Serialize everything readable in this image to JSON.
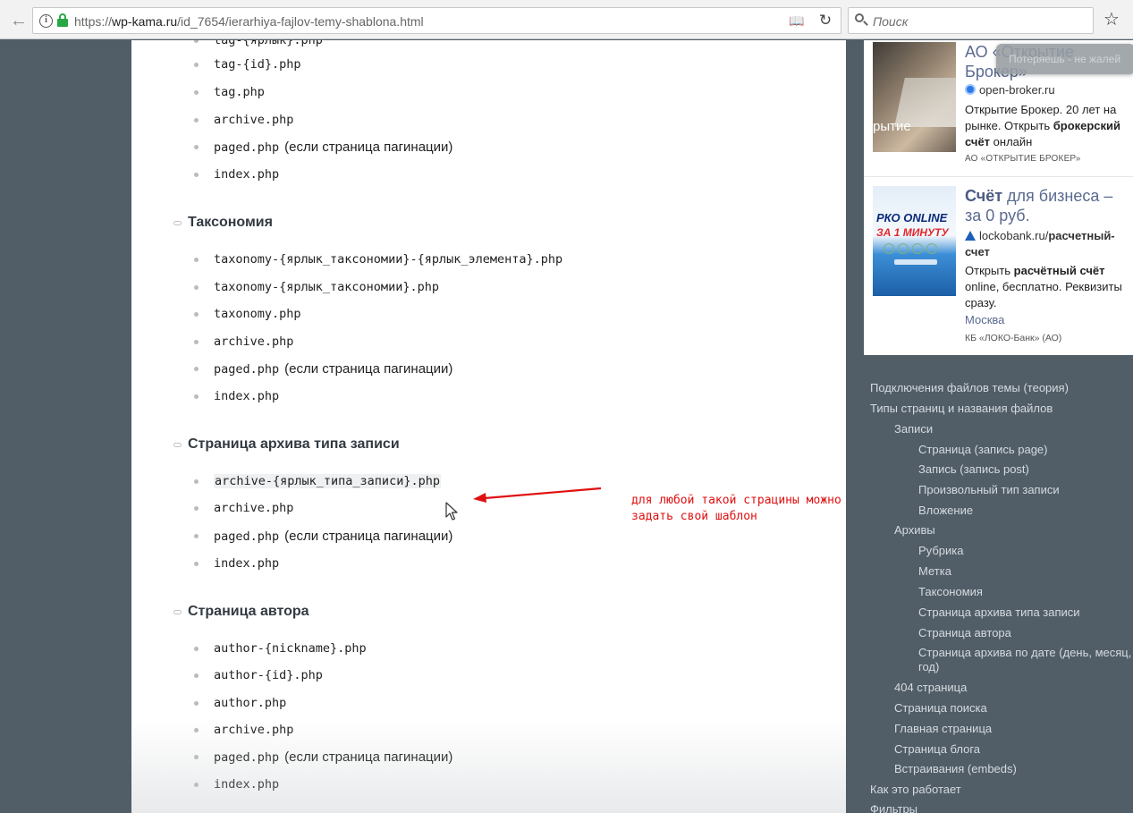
{
  "browser": {
    "url_prefix": "https://",
    "url_host": "wp-kama.ru",
    "url_path": "/id_7654/ierarhiya-fajlov-temy-shablona.html",
    "search_placeholder": "Поиск",
    "icons": [
      "back-arrow-icon",
      "info-icon",
      "lock-icon",
      "reader-view-icon",
      "reload-icon",
      "search-icon",
      "bookmark-star-icon"
    ],
    "lock_color": "#2aa745"
  },
  "content": {
    "top_partial": "tag-{ярлык}.php",
    "tag_list": [
      {
        "code": "tag-{id}.php",
        "note": ""
      },
      {
        "code": "tag.php",
        "note": ""
      },
      {
        "code": "archive.php",
        "note": ""
      },
      {
        "code": "paged.php",
        "note": "(если страница пагинации)"
      },
      {
        "code": "index.php",
        "note": ""
      }
    ],
    "sections": [
      {
        "title": "Таксономия",
        "items": [
          {
            "code": "taxonomy-{ярлык_таксономии}-{ярлык_элемента}.php",
            "note": ""
          },
          {
            "code": "taxonomy-{ярлык_таксономии}.php",
            "note": ""
          },
          {
            "code": "taxonomy.php",
            "note": ""
          },
          {
            "code": "archive.php",
            "note": ""
          },
          {
            "code": "paged.php",
            "note": "(если страница пагинации)"
          },
          {
            "code": "index.php",
            "note": ""
          }
        ]
      },
      {
        "title": "Страница архива типа записи",
        "items": [
          {
            "code": "archive-{ярлык_типа_записи}.php",
            "note": ""
          },
          {
            "code": "archive.php",
            "note": ""
          },
          {
            "code": "paged.php",
            "note": "(если страница пагинации)"
          },
          {
            "code": "index.php",
            "note": ""
          }
        ]
      },
      {
        "title": "Страница автора",
        "items": [
          {
            "code": "author-{nickname}.php",
            "note": ""
          },
          {
            "code": "author-{id}.php",
            "note": ""
          },
          {
            "code": "author.php",
            "note": ""
          },
          {
            "code": "archive.php",
            "note": ""
          },
          {
            "code": "paged.php",
            "note": "(если страница пагинации)"
          },
          {
            "code": "index.php",
            "note": ""
          }
        ]
      }
    ]
  },
  "annotation": {
    "line1": "для любой такой страцины можно",
    "line2": "задать свой шаблон",
    "color": "#e01010"
  },
  "ads": {
    "ad1": {
      "title_line1": "АО «Открытие",
      "title_line2": "Брокер»",
      "image_text": "рытие",
      "host": "open-broker.ru",
      "desc_plain": "Открытие Брокер. 20 лет на рынке. Открыть ",
      "desc_bold": "брокерский счёт",
      "desc_tail": " онлайн",
      "org": "АО «ОТКРЫТИЕ БРОКЕР»"
    },
    "ad2": {
      "title_bold": "Счёт",
      "title_rest": " для бизнеса – за 0 руб.",
      "image_line1": "РКО ONLINE",
      "image_line2": "ЗА 1 МИНУТУ",
      "host": "lockobank.ru/",
      "host_path": "расчетный-счет",
      "desc_plain": "Открыть ",
      "desc_bold": "расчётный счёт",
      "desc_tail": " online, бесплатно. Реквизиты сразу.",
      "city": "Москва",
      "org": "КБ «ЛОКО-Банк» (АО)"
    },
    "popup_text": "Потеряешь - не жалей"
  },
  "toc": [
    {
      "label": "Подключения файлов темы (теория)",
      "level": 0
    },
    {
      "label": "Типы страниц и названия файлов",
      "level": 0
    },
    {
      "label": "Записи",
      "level": 1
    },
    {
      "label": "Страница (запись page)",
      "level": 2
    },
    {
      "label": "Запись (запись post)",
      "level": 2
    },
    {
      "label": "Произвольный тип записи",
      "level": 2
    },
    {
      "label": "Вложение",
      "level": 2
    },
    {
      "label": "Архивы",
      "level": 1
    },
    {
      "label": "Рубрика",
      "level": 2
    },
    {
      "label": "Метка",
      "level": 2
    },
    {
      "label": "Таксономия",
      "level": 2
    },
    {
      "label": "Страница архива типа записи",
      "level": 2
    },
    {
      "label": "Страница автора",
      "level": 2
    },
    {
      "label": "Страница архива по дате (день, месяц,",
      "level": 2
    },
    {
      "label": "год)",
      "level": 2
    },
    {
      "label": "404 страница",
      "level": 1
    },
    {
      "label": "Страница поиска",
      "level": 1
    },
    {
      "label": "Главная страница",
      "level": 1
    },
    {
      "label": "Страница блога",
      "level": 1
    },
    {
      "label": "Встраивания (embeds)",
      "level": 1
    },
    {
      "label": "Как это работает",
      "level": 0
    },
    {
      "label": "Фильтры",
      "level": 0
    }
  ]
}
